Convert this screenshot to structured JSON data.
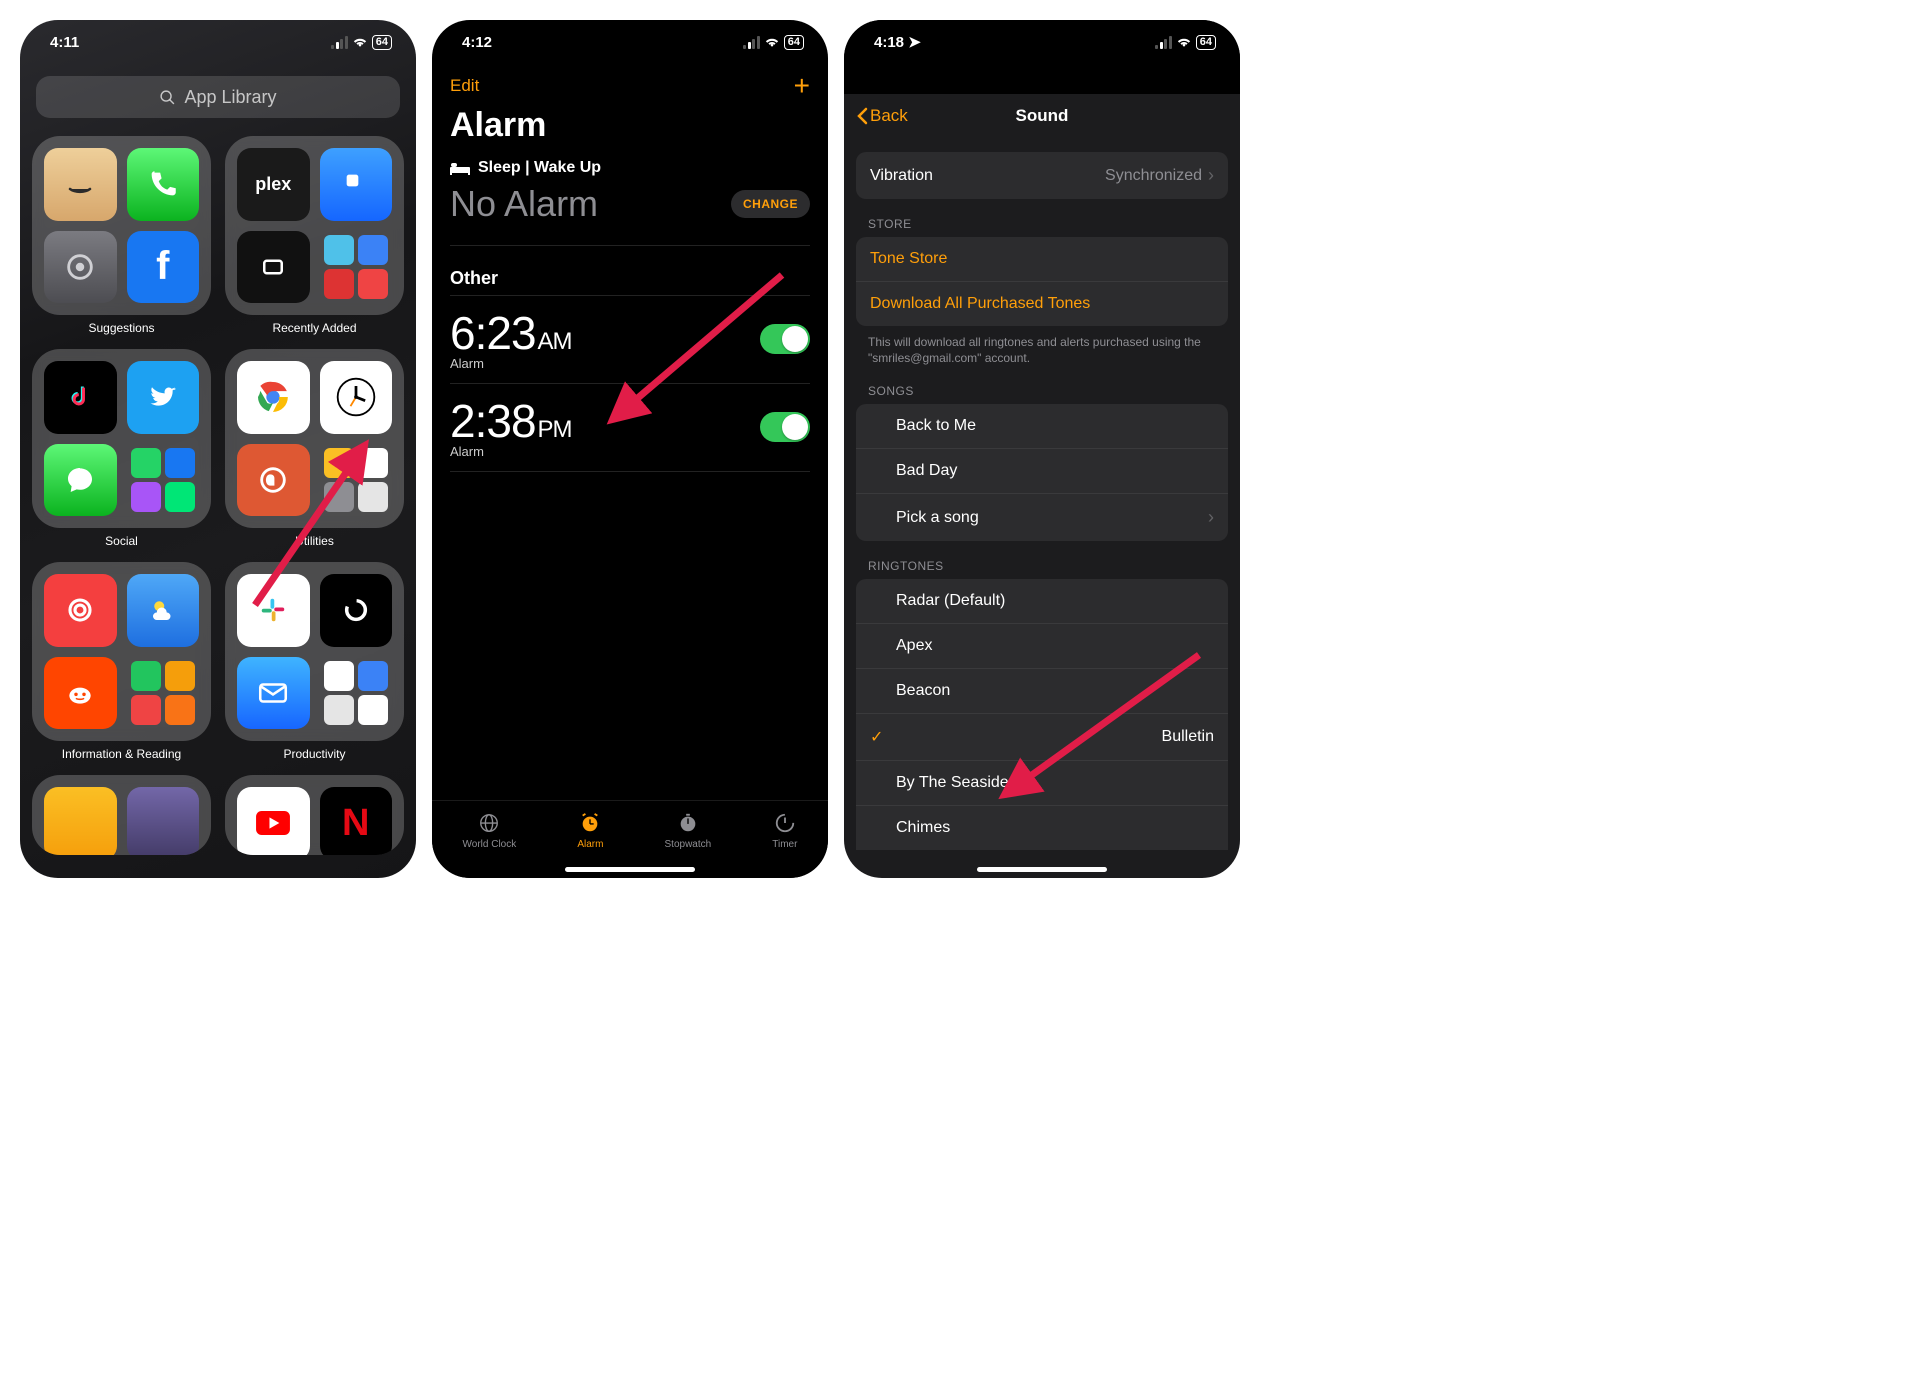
{
  "screen1": {
    "time": "4:11",
    "battery": "64",
    "search_placeholder": "App Library",
    "folders": [
      {
        "label": "Suggestions"
      },
      {
        "label": "Recently Added"
      },
      {
        "label": "Social"
      },
      {
        "label": "Utilities"
      },
      {
        "label": "Information & Reading"
      },
      {
        "label": "Productivity"
      }
    ]
  },
  "screen2": {
    "time": "4:12",
    "battery": "64",
    "edit": "Edit",
    "title": "Alarm",
    "sleep_header": "Sleep | Wake Up",
    "no_alarm": "No Alarm",
    "change": "CHANGE",
    "other_header": "Other",
    "alarms": [
      {
        "time": "6:23",
        "ampm": "AM",
        "sub": "Alarm"
      },
      {
        "time": "2:38",
        "ampm": "PM",
        "sub": "Alarm"
      }
    ],
    "tabs": [
      {
        "label": "World Clock"
      },
      {
        "label": "Alarm"
      },
      {
        "label": "Stopwatch"
      },
      {
        "label": "Timer"
      }
    ]
  },
  "screen3": {
    "time": "4:18",
    "battery": "64",
    "back": "Back",
    "title": "Sound",
    "vibration_label": "Vibration",
    "vibration_value": "Synchronized",
    "store_header": "STORE",
    "tone_store": "Tone Store",
    "download_all": "Download All Purchased Tones",
    "download_footer": "This will download all ringtones and alerts purchased using the \"smriles@gmail.com\" account.",
    "songs_header": "SONGS",
    "songs": [
      {
        "label": "Back to Me"
      },
      {
        "label": "Bad Day"
      },
      {
        "label": "Pick a song",
        "chevron": true
      }
    ],
    "ringtones_header": "RINGTONES",
    "ringtones": [
      {
        "label": "Radar (Default)"
      },
      {
        "label": "Apex"
      },
      {
        "label": "Beacon"
      },
      {
        "label": "Bulletin",
        "selected": true
      },
      {
        "label": "By The Seaside"
      },
      {
        "label": "Chimes"
      }
    ]
  }
}
